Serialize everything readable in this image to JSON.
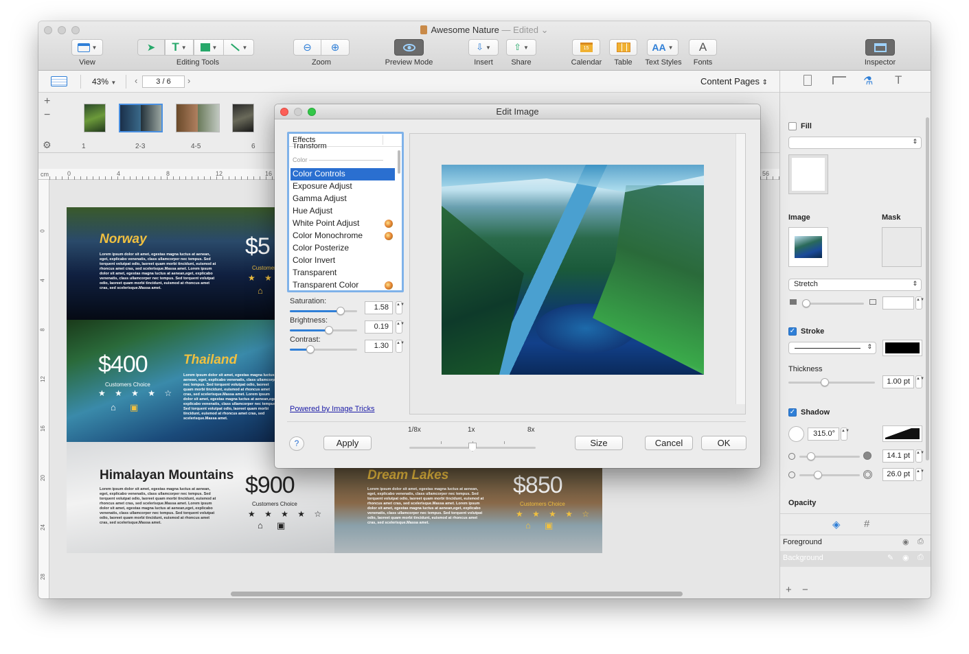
{
  "window": {
    "title": "Awesome Nature",
    "edited": "— Edited",
    "title_caret": "⌄"
  },
  "toolbar": {
    "view": "View",
    "editing_tools": "Editing Tools",
    "zoom": "Zoom",
    "preview_mode": "Preview Mode",
    "insert": "Insert",
    "share": "Share",
    "calendar": "Calendar",
    "calendar_day": "15",
    "table": "Table",
    "text_styles": "Text Styles",
    "fonts": "Fonts",
    "fonts_glyph": "A",
    "text_tool_glyph": "T",
    "text_styles_glyph": "AA",
    "inspector": "Inspector"
  },
  "subbar": {
    "zoom_level": "43%",
    "page_field": "3 / 6",
    "content_pages": "Content Pages"
  },
  "thumbnails": [
    {
      "label": "1"
    },
    {
      "label": "2-3"
    },
    {
      "label": "4-5"
    },
    {
      "label": "6"
    }
  ],
  "ruler": {
    "unit": "cm",
    "ticks": [
      "0",
      "4",
      "8",
      "12",
      "16",
      "56"
    ],
    "vticks": [
      "0",
      "4",
      "8",
      "12",
      "16",
      "20",
      "24",
      "28"
    ]
  },
  "posters": {
    "norway": {
      "title": "Norway",
      "price": "$5",
      "sub": "Customers",
      "stars": "★ ★ ★"
    },
    "thailand": {
      "title": "Thailand",
      "price": "$400",
      "sub": "Customers Choice",
      "stars": "★ ★ ★ ★ ☆"
    },
    "himalaya": {
      "title": "Himalayan Mountains",
      "price": "$900",
      "sub": "Customers Choice",
      "stars": "★ ★ ★ ★ ☆"
    },
    "dream": {
      "title": "Dream Lakes",
      "price": "$850",
      "sub": "Customers Choice",
      "stars": "★ ★ ★ ★ ☆"
    },
    "lorem": "Lorem ipsum dolor sit amet, egestas magna luctus at aenean, eget, explicabo venenatis, class ullamcorper nec tempus. Sed torquent volutpat odio, laoreet quam morbi tincidunt, euismod at rhoncus amet cras, sed scelerisque.Massa amet. Lorem ipsum dolor sit amet, egestas magna luctus at aenean,eget, explicabo venenatis, class ullamcorper nec tempus. Sed torquent volutpat odio, laoreet quam morbi tincidunt, euismod at rhoncus amet cras, sed scelerisque.Massa amet."
  },
  "dialog": {
    "title": "Edit Image",
    "effects_header": "Effects",
    "transform_partial": "Transform",
    "color_section": "Color",
    "effects": [
      {
        "label": "Color Controls",
        "selected": true,
        "badge": false
      },
      {
        "label": "Exposure Adjust",
        "selected": false,
        "badge": false
      },
      {
        "label": "Gamma Adjust",
        "selected": false,
        "badge": false
      },
      {
        "label": "Hue Adjust",
        "selected": false,
        "badge": false
      },
      {
        "label": "White Point Adjust",
        "selected": false,
        "badge": true
      },
      {
        "label": "Color Monochrome",
        "selected": false,
        "badge": true
      },
      {
        "label": "Color Posterize",
        "selected": false,
        "badge": false
      },
      {
        "label": "Color Invert",
        "selected": false,
        "badge": false
      },
      {
        "label": "Transparent",
        "selected": false,
        "badge": false
      },
      {
        "label": "Transparent Color",
        "selected": false,
        "badge": true
      }
    ],
    "saturation_label": "Saturation:",
    "saturation_value": "1.58",
    "saturation_level": 0.75,
    "brightness_label": "Brightness:",
    "brightness_value": "0.19",
    "brightness_level": 0.58,
    "contrast_label": "Contrast:",
    "contrast_value": "1.30",
    "contrast_level": 0.31,
    "powered_by": "Powered by Image Tricks",
    "help": "?",
    "apply": "Apply",
    "zoom_min": "1/8x",
    "zoom_mid": "1x",
    "zoom_max": "8x",
    "zoom_level": 0.5,
    "size": "Size",
    "cancel": "Cancel",
    "ok": "OK"
  },
  "inspector": {
    "fill": "Fill",
    "image": "Image",
    "mask": "Mask",
    "stretch": "Stretch",
    "stroke": "Stroke",
    "thickness": "Thickness",
    "thickness_value": "1.00 pt",
    "shadow": "Shadow",
    "shadow_angle": "315.0°",
    "shadow_offset": "14.1 pt",
    "shadow_blur": "26.0 pt",
    "opacity": "Opacity",
    "layers": [
      {
        "label": "Foreground",
        "selected": false
      },
      {
        "label": "Background",
        "selected": true
      }
    ]
  },
  "colors": {
    "accent": "#2f7fd7",
    "selection": "#2a6fd0",
    "poster_gold": "#f0c040"
  }
}
